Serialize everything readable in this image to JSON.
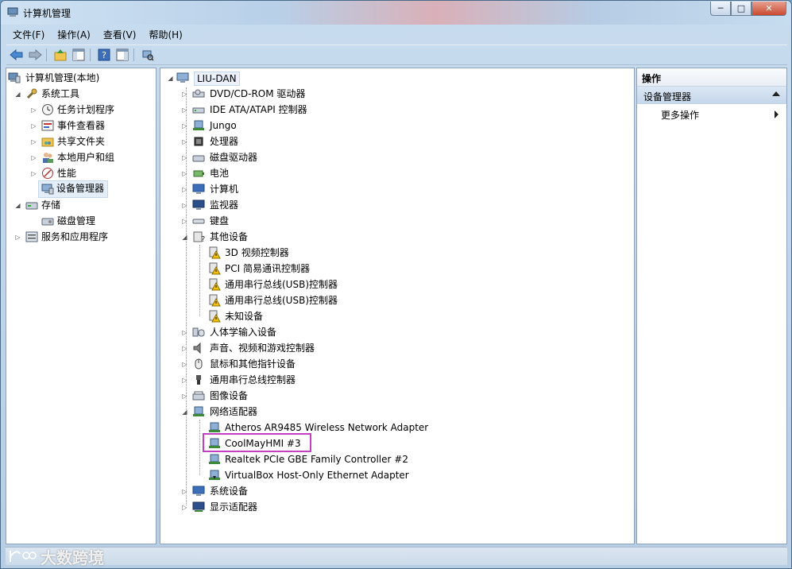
{
  "window": {
    "title": "计算机管理"
  },
  "window_buttons": {
    "minimize": "─",
    "maximize": "□",
    "close": "✕"
  },
  "menu": [
    "文件(F)",
    "操作(A)",
    "查看(V)",
    "帮助(H)"
  ],
  "left_tree": {
    "root": "计算机管理(本地)",
    "system_tools": "系统工具",
    "task_scheduler": "任务计划程序",
    "event_viewer": "事件查看器",
    "shared_folders": "共享文件夹",
    "local_users": "本地用户和组",
    "performance": "性能",
    "device_manager": "设备管理器",
    "storage": "存储",
    "disk_management": "磁盘管理",
    "services": "服务和应用程序"
  },
  "device_tree": {
    "computer_name": "LIU-DAN",
    "categories": [
      "DVD/CD-ROM 驱动器",
      "IDE ATA/ATAPI 控制器",
      "Jungo",
      "处理器",
      "磁盘驱动器",
      "电池",
      "计算机",
      "监视器",
      "键盘",
      "其他设备"
    ],
    "other_devices": [
      "3D 视频控制器",
      "PCI 简易通讯控制器",
      "通用串行总线(USB)控制器",
      "通用串行总线(USB)控制器",
      "未知设备"
    ],
    "categories2": [
      "人体学输入设备",
      "声音、视频和游戏控制器",
      "鼠标和其他指针设备",
      "通用串行总线控制器",
      "图像设备",
      "网络适配器"
    ],
    "network_adapters": [
      "Atheros AR9485 Wireless Network Adapter",
      "CoolMayHMI #3",
      "Realtek PCIe GBE Family Controller #2",
      "VirtualBox Host-Only Ethernet Adapter"
    ],
    "categories3": [
      "系统设备",
      "显示适配器"
    ]
  },
  "actions": {
    "header": "操作",
    "section": "设备管理器",
    "more": "更多操作"
  },
  "watermark": "大数跨境",
  "colors": {
    "highlight": "#c43fc4",
    "warning": "#f2c200"
  }
}
